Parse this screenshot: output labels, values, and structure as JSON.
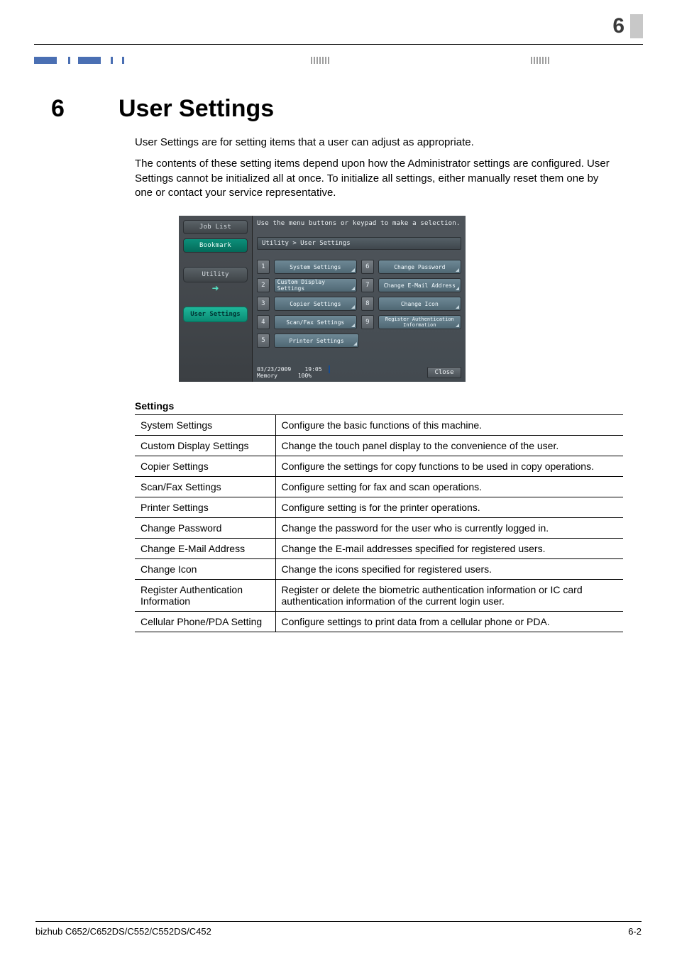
{
  "chapter_number_top": "6",
  "heading_number": "6",
  "heading_text": "User Settings",
  "paragraphs": [
    "User Settings are for setting items that a user can adjust as appropriate.",
    "The contents of these setting items depend upon how the Administrator settings are configured. User Settings cannot be initialized all at once. To initialize all settings, either manually reset them one by one or contact your service representative."
  ],
  "shot": {
    "hint": "Use the menu buttons or keypad to make a selection.",
    "breadcrumb": "Utility > User Settings",
    "left_tabs": {
      "job_list": "Job List",
      "bookmark": "Bookmark"
    },
    "left_nav": {
      "utility": "Utility",
      "user_settings": "User Settings"
    },
    "menu_left": [
      {
        "n": "1",
        "label": "System Settings"
      },
      {
        "n": "2",
        "label": "Custom Display Settings"
      },
      {
        "n": "3",
        "label": "Copier Settings"
      },
      {
        "n": "4",
        "label": "Scan/Fax Settings"
      },
      {
        "n": "5",
        "label": "Printer Settings"
      }
    ],
    "menu_right": [
      {
        "n": "6",
        "label": "Change Password"
      },
      {
        "n": "7",
        "label": "Change E-Mail Address"
      },
      {
        "n": "8",
        "label": "Change Icon"
      },
      {
        "n": "9",
        "label": "Register Authentication\nInformation"
      }
    ],
    "status": {
      "date": "03/23/2009",
      "time": "19:05",
      "memory_label": "Memory",
      "memory_value": "100%",
      "close": "Close"
    }
  },
  "settings_title": "Settings",
  "settings_rows": [
    {
      "name": "System Settings",
      "desc": "Configure the basic functions of this machine."
    },
    {
      "name": "Custom Display Settings",
      "desc": "Change the touch panel display to the convenience of the user."
    },
    {
      "name": "Copier Settings",
      "desc": "Configure the settings for copy functions to be used in copy operations."
    },
    {
      "name": "Scan/Fax Settings",
      "desc": "Configure setting for fax and scan operations."
    },
    {
      "name": "Printer Settings",
      "desc": "Configure setting is for the printer operations."
    },
    {
      "name": "Change Password",
      "desc": "Change the password for the user who is currently logged in."
    },
    {
      "name": "Change E-Mail Address",
      "desc": "Change the E-mail addresses specified for registered users."
    },
    {
      "name": "Change Icon",
      "desc": "Change the icons specified for registered users."
    },
    {
      "name": "Register Authentication Information",
      "desc": "Register or delete the biometric authentication information or IC card authentication information of the current login user."
    },
    {
      "name": "Cellular Phone/PDA Setting",
      "desc": "Configure settings to print data from a cellular phone or PDA."
    }
  ],
  "footer": {
    "left": "bizhub C652/C652DS/C552/C552DS/C452",
    "right": "6-2"
  }
}
